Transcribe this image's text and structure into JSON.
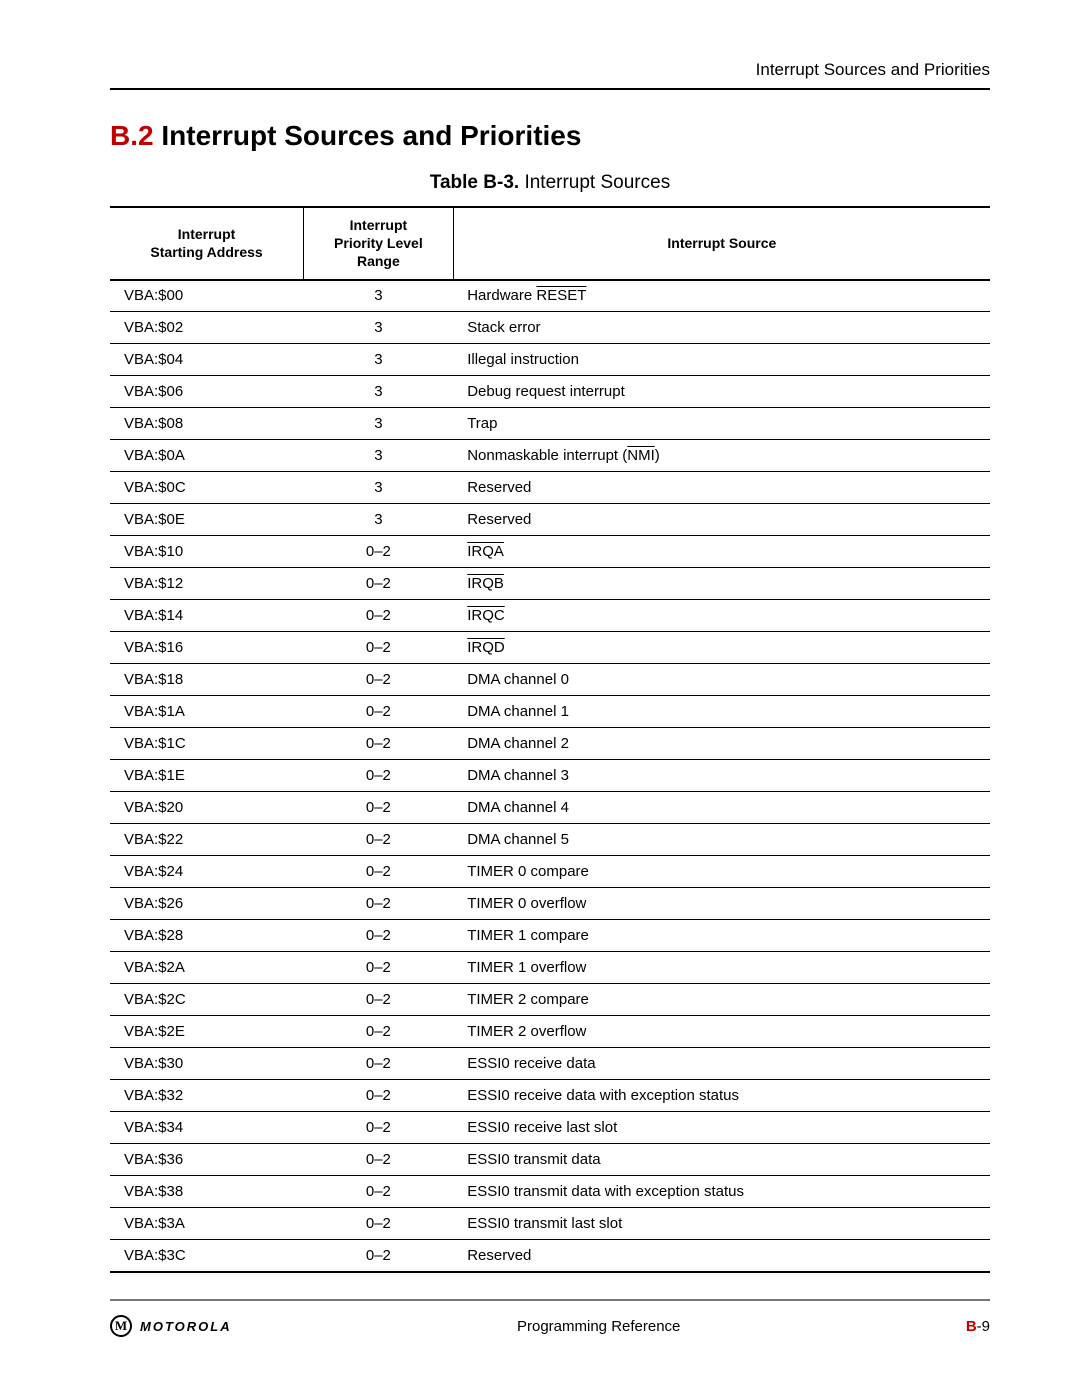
{
  "running_head": "Interrupt Sources and Priorities",
  "section": {
    "number": "B.2",
    "title": "Interrupt Sources and Priorities"
  },
  "table": {
    "caption_bold": "Table B-3.",
    "caption_rest": " Interrupt Sources",
    "headers": {
      "col1_line1": "Interrupt",
      "col1_line2": "Starting Address",
      "col2_line1": "Interrupt",
      "col2_line2": "Priority Level",
      "col2_line3": "Range",
      "col3": "Interrupt Source"
    },
    "rows": [
      {
        "addr": "VBA:$00",
        "prio": "3",
        "src_pre": "Hardware ",
        "src_over": "RESET",
        "src_post": ""
      },
      {
        "addr": "VBA:$02",
        "prio": "3",
        "src_pre": "Stack error",
        "src_over": "",
        "src_post": ""
      },
      {
        "addr": "VBA:$04",
        "prio": "3",
        "src_pre": "Illegal instruction",
        "src_over": "",
        "src_post": ""
      },
      {
        "addr": "VBA:$06",
        "prio": "3",
        "src_pre": "Debug request interrupt",
        "src_over": "",
        "src_post": ""
      },
      {
        "addr": "VBA:$08",
        "prio": "3",
        "src_pre": "Trap",
        "src_over": "",
        "src_post": ""
      },
      {
        "addr": "VBA:$0A",
        "prio": "3",
        "src_pre": "Nonmaskable interrupt (",
        "src_over": "NMI",
        "src_post": ")"
      },
      {
        "addr": "VBA:$0C",
        "prio": "3",
        "src_pre": "Reserved",
        "src_over": "",
        "src_post": ""
      },
      {
        "addr": "VBA:$0E",
        "prio": "3",
        "src_pre": "Reserved",
        "src_over": "",
        "src_post": ""
      },
      {
        "addr": "VBA:$10",
        "prio": "0–2",
        "src_pre": "",
        "src_over": "IRQA",
        "src_post": ""
      },
      {
        "addr": "VBA:$12",
        "prio": "0–2",
        "src_pre": "",
        "src_over": "IRQB",
        "src_post": ""
      },
      {
        "addr": "VBA:$14",
        "prio": "0–2",
        "src_pre": "",
        "src_over": "IRQC",
        "src_post": ""
      },
      {
        "addr": "VBA:$16",
        "prio": "0–2",
        "src_pre": "",
        "src_over": "IRQD",
        "src_post": ""
      },
      {
        "addr": "VBA:$18",
        "prio": "0–2",
        "src_pre": "DMA channel 0",
        "src_over": "",
        "src_post": ""
      },
      {
        "addr": "VBA:$1A",
        "prio": "0–2",
        "src_pre": "DMA channel 1",
        "src_over": "",
        "src_post": ""
      },
      {
        "addr": "VBA:$1C",
        "prio": "0–2",
        "src_pre": "DMA channel 2",
        "src_over": "",
        "src_post": ""
      },
      {
        "addr": "VBA:$1E",
        "prio": "0–2",
        "src_pre": "DMA channel 3",
        "src_over": "",
        "src_post": ""
      },
      {
        "addr": "VBA:$20",
        "prio": "0–2",
        "src_pre": "DMA channel 4",
        "src_over": "",
        "src_post": ""
      },
      {
        "addr": "VBA:$22",
        "prio": "0–2",
        "src_pre": "DMA channel 5",
        "src_over": "",
        "src_post": ""
      },
      {
        "addr": "VBA:$24",
        "prio": "0–2",
        "src_pre": "TIMER 0 compare",
        "src_over": "",
        "src_post": ""
      },
      {
        "addr": "VBA:$26",
        "prio": "0–2",
        "src_pre": "TIMER 0 overflow",
        "src_over": "",
        "src_post": ""
      },
      {
        "addr": "VBA:$28",
        "prio": "0–2",
        "src_pre": "TIMER 1 compare",
        "src_over": "",
        "src_post": ""
      },
      {
        "addr": "VBA:$2A",
        "prio": "0–2",
        "src_pre": "TIMER 1 overflow",
        "src_over": "",
        "src_post": ""
      },
      {
        "addr": "VBA:$2C",
        "prio": "0–2",
        "src_pre": "TIMER 2 compare",
        "src_over": "",
        "src_post": ""
      },
      {
        "addr": "VBA:$2E",
        "prio": "0–2",
        "src_pre": "TIMER 2 overflow",
        "src_over": "",
        "src_post": ""
      },
      {
        "addr": "VBA:$30",
        "prio": "0–2",
        "src_pre": "ESSI0 receive data",
        "src_over": "",
        "src_post": ""
      },
      {
        "addr": "VBA:$32",
        "prio": "0–2",
        "src_pre": "ESSI0 receive data with exception status",
        "src_over": "",
        "src_post": ""
      },
      {
        "addr": "VBA:$34",
        "prio": "0–2",
        "src_pre": "ESSI0 receive last slot",
        "src_over": "",
        "src_post": ""
      },
      {
        "addr": "VBA:$36",
        "prio": "0–2",
        "src_pre": "ESSI0 transmit data",
        "src_over": "",
        "src_post": ""
      },
      {
        "addr": "VBA:$38",
        "prio": "0–2",
        "src_pre": "ESSI0 transmit data with exception status",
        "src_over": "",
        "src_post": ""
      },
      {
        "addr": "VBA:$3A",
        "prio": "0–2",
        "src_pre": "ESSI0 transmit last slot",
        "src_over": "",
        "src_post": ""
      },
      {
        "addr": "VBA:$3C",
        "prio": "0–2",
        "src_pre": "Reserved",
        "src_over": "",
        "src_post": ""
      }
    ]
  },
  "footer": {
    "logo_letter": "M",
    "brand": "MOTOROLA",
    "center": "Programming Reference",
    "page_prefix": "B",
    "page_sep": "-",
    "page_num": "9"
  }
}
